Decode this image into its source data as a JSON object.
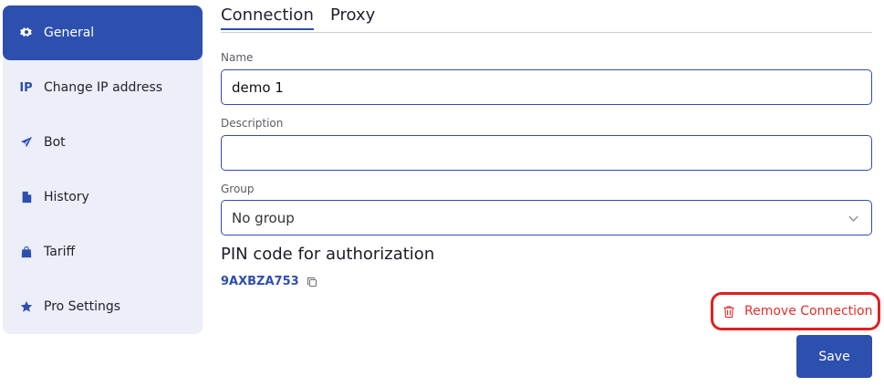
{
  "sidebar": {
    "items": [
      {
        "label": "General",
        "icon": "gear-icon",
        "active": true
      },
      {
        "label": "Change IP address",
        "icon": "ip-icon",
        "icon_text": "IP"
      },
      {
        "label": "Bot",
        "icon": "send-icon"
      },
      {
        "label": "History",
        "icon": "document-icon"
      },
      {
        "label": "Tariff",
        "icon": "bag-icon"
      },
      {
        "label": "Pro Settings",
        "icon": "star-icon"
      }
    ]
  },
  "tabs": [
    {
      "label": "Connection",
      "active": true
    },
    {
      "label": "Proxy"
    }
  ],
  "form": {
    "name_label": "Name",
    "name_value": "demo 1",
    "description_label": "Description",
    "description_value": "",
    "group_label": "Group",
    "group_value": "No group"
  },
  "pin": {
    "title": "PIN code for authorization",
    "code": "9AXBZA753"
  },
  "actions": {
    "remove_label": "Remove Connection",
    "save_label": "Save"
  },
  "colors": {
    "accent": "#2d4fae",
    "sidebar_bg": "#eceef8",
    "danger": "#e0302a"
  }
}
